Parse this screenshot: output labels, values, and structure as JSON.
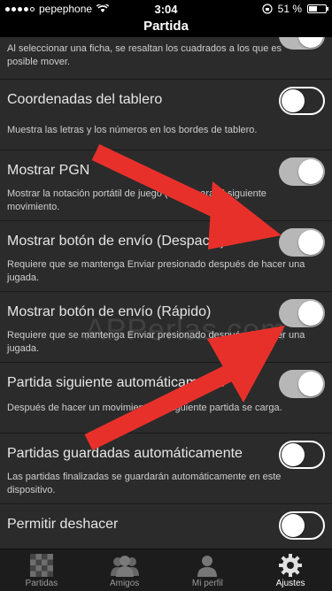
{
  "status": {
    "carrier": "pepephone",
    "time": "3:04",
    "battery": "51 %",
    "battery_level": 0.51
  },
  "header": {
    "title": "Partida"
  },
  "settings": [
    {
      "title": "",
      "desc": "Al seleccionar una ficha, se resaltan los cuadrados a los que es posible mover.",
      "on": true
    },
    {
      "title": "Coordenadas del tablero",
      "desc": "Muestra las letras y los números en los bordes de tablero.",
      "on": false
    },
    {
      "title": "Mostrar PGN",
      "desc": "Mostrar la notación portátil de juego (PGN) para el siguiente movimiento.",
      "on": true
    },
    {
      "title": "Mostrar botón de envío (Despacio)",
      "desc": "Requiere que se mantenga Enviar presionado después de hacer una jugada.",
      "on": true
    },
    {
      "title": "Mostrar botón de envío (Rápido)",
      "desc": "Requiere que se mantenga Enviar presionado después de hacer una jugada.",
      "on": true
    },
    {
      "title": "Partida siguiente automáticamente",
      "desc": "Después de hacer un movimiento, la siguiente partida se carga.",
      "on": true
    },
    {
      "title": "Partidas guardadas automáticamente",
      "desc": "Las partidas finalizadas se guardarán automáticamente en este dispositivo.",
      "on": false
    },
    {
      "title": "Permitir deshacer",
      "desc": "",
      "on": false
    }
  ],
  "tabs": [
    {
      "label": "Partidas",
      "icon": "chessboard-icon"
    },
    {
      "label": "Amigos",
      "icon": "friends-icon"
    },
    {
      "label": "Mi perfil",
      "icon": "profile-icon"
    },
    {
      "label": "Ajustes",
      "icon": "gear-icon"
    }
  ],
  "watermark": "APPerlas.com",
  "colors": {
    "arrow": "#e8302a",
    "toggle_on": "#b7b7b7",
    "background": "#2b2b2b"
  }
}
